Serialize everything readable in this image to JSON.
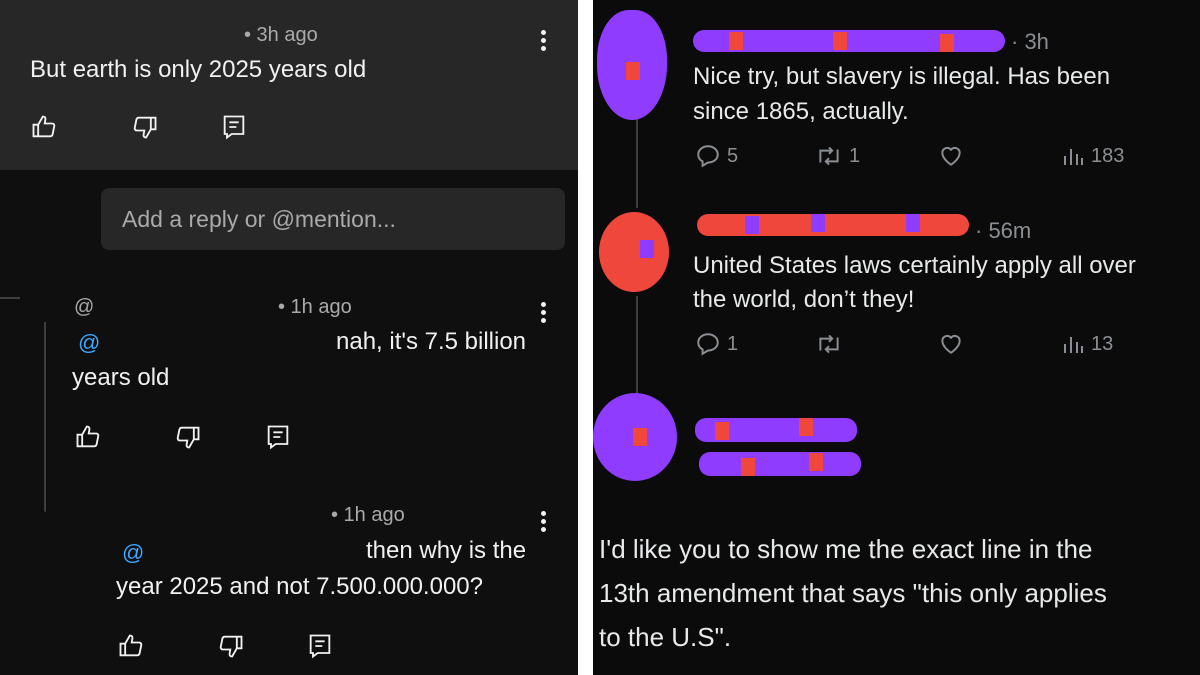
{
  "left": {
    "comment1": {
      "time": "• 3h ago",
      "text": "But earth is only 2025 years old"
    },
    "reply_input": {
      "placeholder": "Add a reply or @mention..."
    },
    "reply1": {
      "author": "@",
      "time": "• 1h ago",
      "mention": "@",
      "text_line1": "nah, it's 7.5 billion",
      "text_line2": "years old"
    },
    "reply2": {
      "time": "• 1h ago",
      "mention": "@",
      "text_line1": "then why is the",
      "text_line2": "year 2025 and not 7.500.000.000?"
    }
  },
  "right": {
    "tweet1": {
      "time": "· 3h",
      "text_line1": "Nice try, but slavery is illegal. Has been",
      "text_line2": "since 1865, actually.",
      "replies": "5",
      "reposts": "1",
      "views": "183"
    },
    "tweet2": {
      "time": "· 56m",
      "text_line1": "United States laws certainly apply all over",
      "text_line2": "the world, don’t they!",
      "replies": "1",
      "views": "13"
    },
    "tweet3": {
      "text_line1": "I'd like you to show me the exact line in the",
      "text_line2": "13th amendment that says \"this only applies",
      "text_line3": "to the U.S\"."
    }
  },
  "colors": {
    "redact_purple": "#8f3cff",
    "redact_red": "#f0473c",
    "link_blue": "#3ea6ff"
  }
}
